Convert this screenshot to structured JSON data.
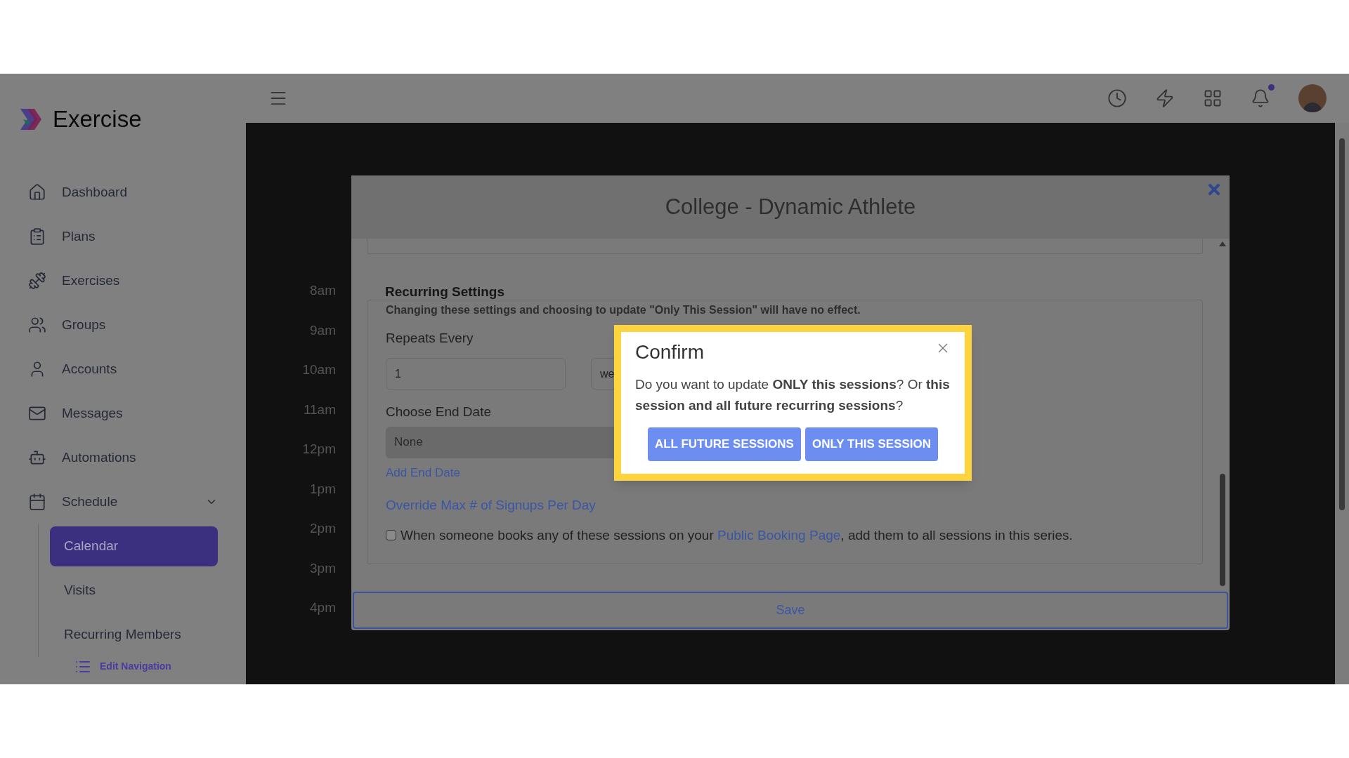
{
  "sidebar": {
    "brand": "Exercise",
    "items": [
      {
        "label": "Dashboard",
        "selected": false
      },
      {
        "label": "Plans",
        "selected": false
      },
      {
        "label": "Exercises",
        "selected": false
      },
      {
        "label": "Groups",
        "selected": false
      },
      {
        "label": "Accounts",
        "selected": false
      },
      {
        "label": "Messages",
        "selected": false
      },
      {
        "label": "Automations",
        "selected": false
      },
      {
        "label": "Schedule",
        "selected": false,
        "expanded": true,
        "children": [
          {
            "label": "Calendar",
            "selected": true
          },
          {
            "label": "Visits",
            "selected": false
          },
          {
            "label": "Recurring Members",
            "selected": false
          }
        ]
      }
    ],
    "edit_navigation": "Edit Navigation"
  },
  "topbar": {
    "notifications_unread": true
  },
  "calendar": {
    "time_labels": [
      "8am",
      "9am",
      "10am",
      "11am",
      "12pm",
      "1pm",
      "2pm",
      "3pm",
      "4pm"
    ]
  },
  "modal": {
    "title": "College - Dynamic Athlete",
    "heading": "Recurring Settings",
    "note": "Changing these settings and choosing to update \"Only This Session\" will have no effect.",
    "repeats_label": "Repeats Every",
    "repeats_value": "1",
    "repeats_unit": "we",
    "end_date_label": "Choose End Date",
    "end_date_value": "None",
    "add_end_date": "Add End Date",
    "override_link": "Override Max # of Signups Per Day",
    "booking": {
      "checked": false,
      "before": "When someone books any of these sessions on your ",
      "link": "Public Booking Page",
      "after": ", add them to all sessions in this series."
    },
    "save": "Save"
  },
  "confirm": {
    "title": "Confirm",
    "message": "Do you want to update **ONLY this sessions**? Or **this session and all future recurring sessions**?",
    "buttons": [
      "ALL FUTURE SESSIONS",
      "ONLY THIS SESSION"
    ]
  }
}
